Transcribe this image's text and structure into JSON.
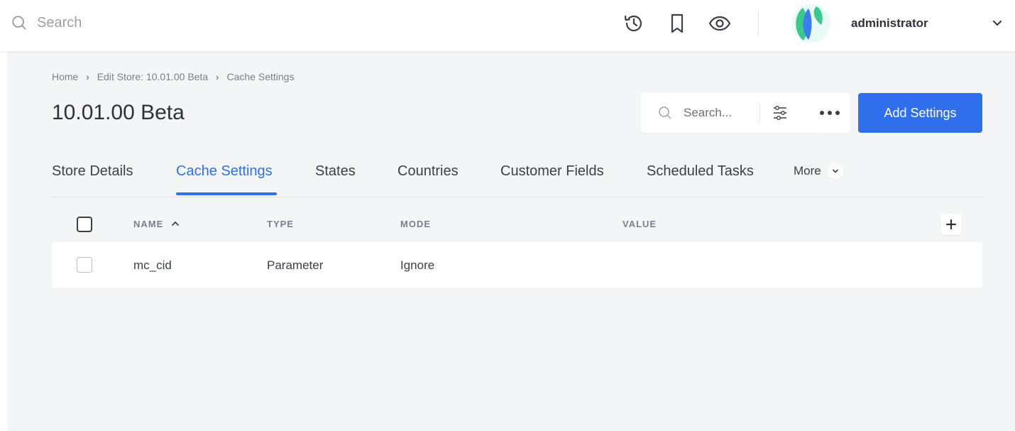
{
  "topbar": {
    "search_placeholder": "Search",
    "username": "administrator",
    "icons": [
      "history-icon",
      "bookmark-icon",
      "eye-icon"
    ]
  },
  "breadcrumb": [
    "Home",
    "Edit Store: 10.01.00 Beta",
    "Cache Settings"
  ],
  "page": {
    "title": "10.01.00 Beta",
    "search_placeholder": "Search...",
    "add_button": "Add Settings"
  },
  "tabs": [
    {
      "label": "Store Details",
      "active": false
    },
    {
      "label": "Cache Settings",
      "active": true
    },
    {
      "label": "States",
      "active": false
    },
    {
      "label": "Countries",
      "active": false
    },
    {
      "label": "Customer Fields",
      "active": false
    },
    {
      "label": "Scheduled Tasks",
      "active": false
    }
  ],
  "tab_more_label": "More",
  "table": {
    "columns": [
      "NAME",
      "TYPE",
      "MODE",
      "VALUE"
    ],
    "sort_column": "NAME",
    "rows": [
      {
        "name": "mc_cid",
        "type": "Parameter",
        "mode": "Ignore",
        "value": ""
      }
    ]
  },
  "colors": {
    "accent": "#2f6fec",
    "background": "#f4f5f7",
    "text": "#3b3f47"
  }
}
